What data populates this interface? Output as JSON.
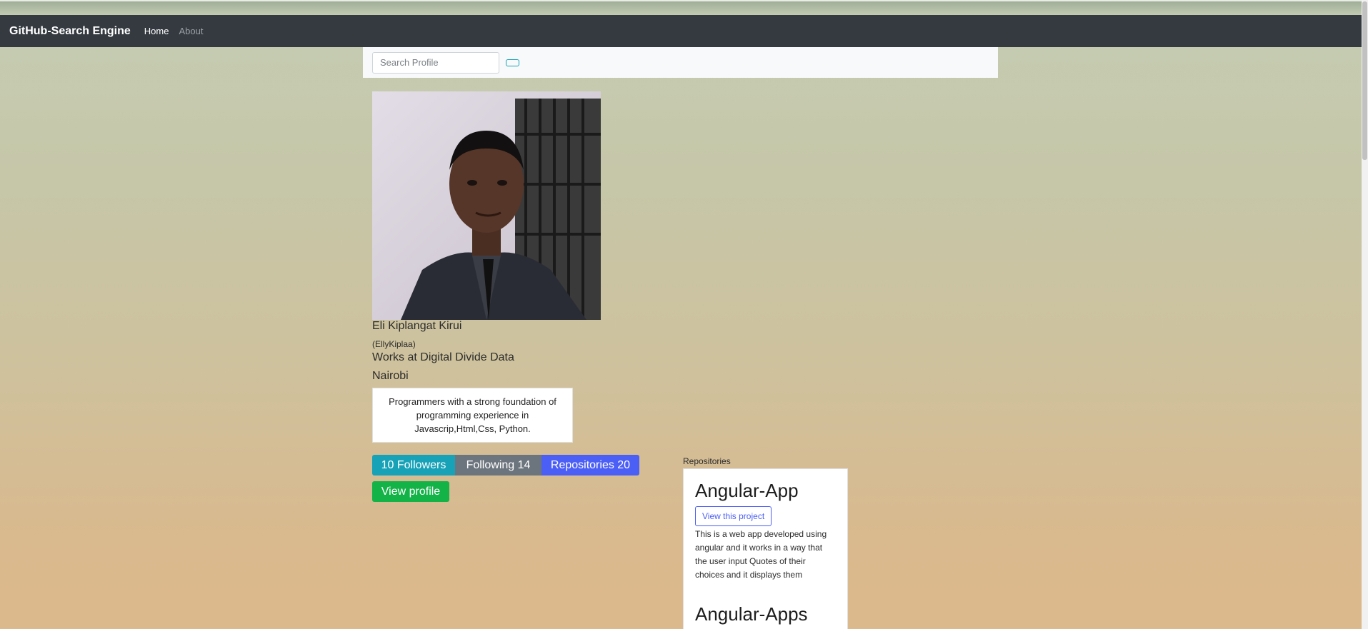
{
  "navbar": {
    "brand": "GitHub-Search Engine",
    "links": [
      {
        "label": "Home",
        "active": true
      },
      {
        "label": "About",
        "active": false
      }
    ]
  },
  "search": {
    "placeholder": "Search Profile",
    "value": ""
  },
  "profile": {
    "avatar_alt": "profile photo",
    "name": "Eli Kiplangat Kirui",
    "login": "(EllyKiplaa)",
    "company": "Works at Digital Divide Data",
    "location": "Nairobi",
    "bio": "Programmers with a strong foundation of programming experience in Javascrip,Html,Css, Python.",
    "followers_label": "10 Followers",
    "following_label": "Following 14",
    "repositories_label": "Repositories 20",
    "view_profile_label": "View profile"
  },
  "repositories": {
    "heading": "Repositories",
    "items": [
      {
        "name": "Angular-App",
        "button_label": "View this project",
        "description": "This is a web app developed using angular and it works in a way that the user input Quotes of their choices and it displays them"
      },
      {
        "name": "Angular-Apps"
      }
    ]
  },
  "colors": {
    "navbar_bg": "#343a40",
    "followers": "#17a2b8",
    "following": "#6c757d",
    "repositories": "#4b5ff6",
    "view_profile": "#13b348"
  }
}
